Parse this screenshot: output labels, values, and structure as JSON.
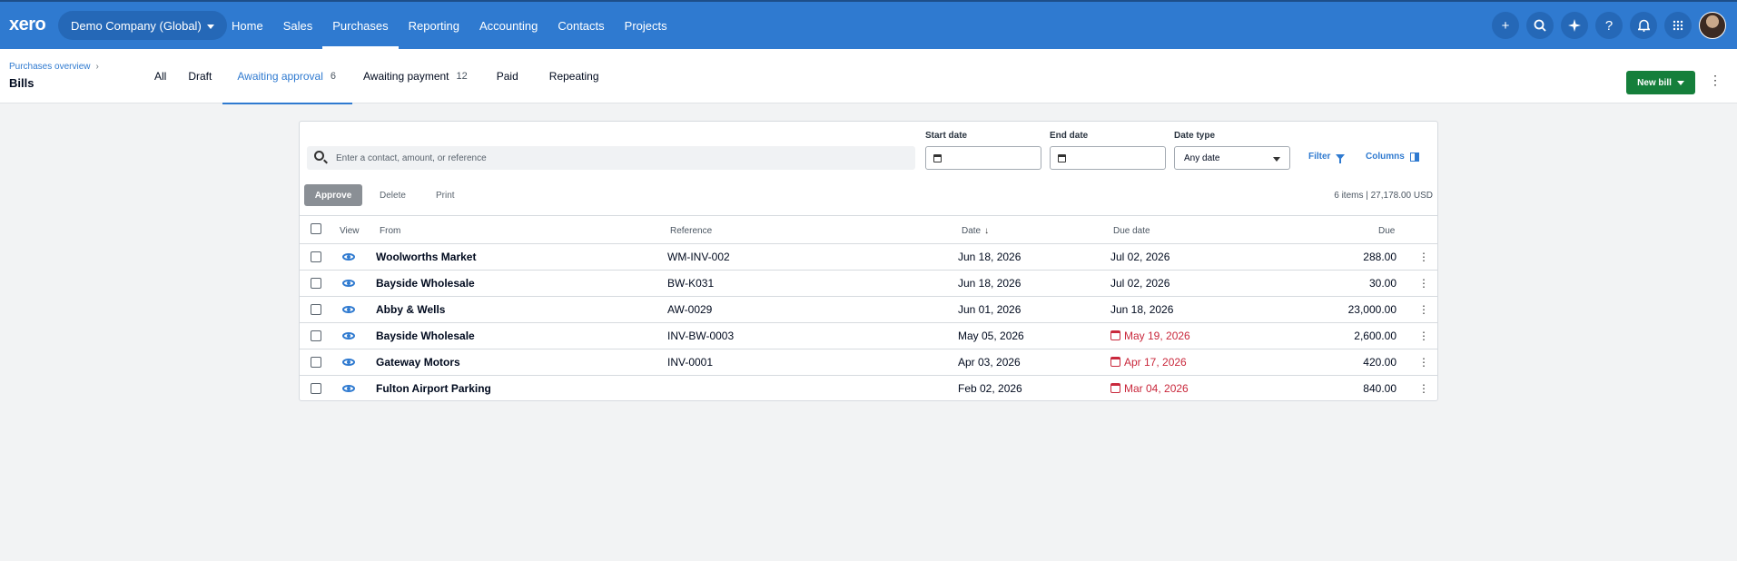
{
  "nav": {
    "logo": "xero",
    "org": "Demo Company (Global)",
    "links": [
      "Home",
      "Sales",
      "Purchases",
      "Reporting",
      "Accounting",
      "Contacts",
      "Projects"
    ],
    "active": "Purchases",
    "icons": [
      "plus-icon",
      "search-icon",
      "sparkle-icon",
      "help-icon",
      "bell-icon",
      "apps-grid-icon"
    ]
  },
  "header": {
    "breadcrumb": "Purchases overview",
    "title": "Bills",
    "tabs": [
      {
        "label": "All",
        "count": ""
      },
      {
        "label": "Draft",
        "count": ""
      },
      {
        "label": "Awaiting approval",
        "count": "6"
      },
      {
        "label": "Awaiting payment",
        "count": "12"
      },
      {
        "label": "Paid",
        "count": ""
      },
      {
        "label": "Repeating",
        "count": ""
      }
    ],
    "active_tab": "Awaiting approval",
    "new_bill": "New bill"
  },
  "filters": {
    "search_placeholder": "Enter a contact, amount, or reference",
    "start_date_label": "Start date",
    "end_date_label": "End date",
    "date_type_label": "Date type",
    "date_type_value": "Any date",
    "filter": "Filter",
    "columns": "Columns"
  },
  "actions": {
    "approve": "Approve",
    "delete": "Delete",
    "print": "Print",
    "summary": "6 items | 27,178.00 USD"
  },
  "table": {
    "headers": {
      "view": "View",
      "from": "From",
      "reference": "Reference",
      "date": "Date",
      "due_date": "Due date",
      "due": "Due"
    },
    "rows": [
      {
        "from": "Woolworths Market",
        "reference": "WM-INV-002",
        "date": "Jun 18, 2026",
        "due_date": "Jul 02, 2026",
        "overdue": false,
        "due": "288.00"
      },
      {
        "from": "Bayside Wholesale",
        "reference": "BW-K031",
        "date": "Jun 18, 2026",
        "due_date": "Jul 02, 2026",
        "overdue": false,
        "due": "30.00"
      },
      {
        "from": "Abby & Wells",
        "reference": "AW-0029",
        "date": "Jun 01, 2026",
        "due_date": "Jun 18, 2026",
        "overdue": false,
        "due": "23,000.00"
      },
      {
        "from": "Bayside Wholesale",
        "reference": "INV-BW-0003",
        "date": "May 05, 2026",
        "due_date": "May 19, 2026",
        "overdue": true,
        "due": "2,600.00"
      },
      {
        "from": "Gateway Motors",
        "reference": "INV-0001",
        "date": "Apr 03, 2026",
        "due_date": "Apr 17, 2026",
        "overdue": true,
        "due": "420.00"
      },
      {
        "from": "Fulton Airport Parking",
        "reference": "",
        "date": "Feb 02, 2026",
        "due_date": "Mar 04, 2026",
        "overdue": true,
        "due": "840.00"
      }
    ]
  },
  "colors": {
    "nav_bg": "#2f7ad0",
    "accent": "#2f7ad0",
    "new_bill": "#157f3b",
    "overdue": "#c9283c"
  }
}
